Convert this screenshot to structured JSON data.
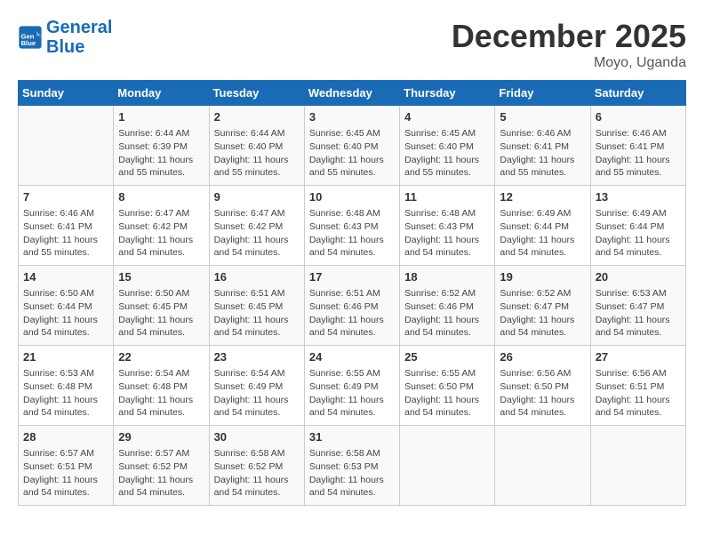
{
  "header": {
    "logo_line1": "General",
    "logo_line2": "Blue",
    "month_year": "December 2025",
    "location": "Moyo, Uganda"
  },
  "days_of_week": [
    "Sunday",
    "Monday",
    "Tuesday",
    "Wednesday",
    "Thursday",
    "Friday",
    "Saturday"
  ],
  "weeks": [
    [
      {
        "day": "",
        "sunrise": "",
        "sunset": "",
        "daylight": ""
      },
      {
        "day": "1",
        "sunrise": "Sunrise: 6:44 AM",
        "sunset": "Sunset: 6:39 PM",
        "daylight": "Daylight: 11 hours and 55 minutes."
      },
      {
        "day": "2",
        "sunrise": "Sunrise: 6:44 AM",
        "sunset": "Sunset: 6:40 PM",
        "daylight": "Daylight: 11 hours and 55 minutes."
      },
      {
        "day": "3",
        "sunrise": "Sunrise: 6:45 AM",
        "sunset": "Sunset: 6:40 PM",
        "daylight": "Daylight: 11 hours and 55 minutes."
      },
      {
        "day": "4",
        "sunrise": "Sunrise: 6:45 AM",
        "sunset": "Sunset: 6:40 PM",
        "daylight": "Daylight: 11 hours and 55 minutes."
      },
      {
        "day": "5",
        "sunrise": "Sunrise: 6:46 AM",
        "sunset": "Sunset: 6:41 PM",
        "daylight": "Daylight: 11 hours and 55 minutes."
      },
      {
        "day": "6",
        "sunrise": "Sunrise: 6:46 AM",
        "sunset": "Sunset: 6:41 PM",
        "daylight": "Daylight: 11 hours and 55 minutes."
      }
    ],
    [
      {
        "day": "7",
        "sunrise": "Sunrise: 6:46 AM",
        "sunset": "Sunset: 6:41 PM",
        "daylight": "Daylight: 11 hours and 55 minutes."
      },
      {
        "day": "8",
        "sunrise": "Sunrise: 6:47 AM",
        "sunset": "Sunset: 6:42 PM",
        "daylight": "Daylight: 11 hours and 54 minutes."
      },
      {
        "day": "9",
        "sunrise": "Sunrise: 6:47 AM",
        "sunset": "Sunset: 6:42 PM",
        "daylight": "Daylight: 11 hours and 54 minutes."
      },
      {
        "day": "10",
        "sunrise": "Sunrise: 6:48 AM",
        "sunset": "Sunset: 6:43 PM",
        "daylight": "Daylight: 11 hours and 54 minutes."
      },
      {
        "day": "11",
        "sunrise": "Sunrise: 6:48 AM",
        "sunset": "Sunset: 6:43 PM",
        "daylight": "Daylight: 11 hours and 54 minutes."
      },
      {
        "day": "12",
        "sunrise": "Sunrise: 6:49 AM",
        "sunset": "Sunset: 6:44 PM",
        "daylight": "Daylight: 11 hours and 54 minutes."
      },
      {
        "day": "13",
        "sunrise": "Sunrise: 6:49 AM",
        "sunset": "Sunset: 6:44 PM",
        "daylight": "Daylight: 11 hours and 54 minutes."
      }
    ],
    [
      {
        "day": "14",
        "sunrise": "Sunrise: 6:50 AM",
        "sunset": "Sunset: 6:44 PM",
        "daylight": "Daylight: 11 hours and 54 minutes."
      },
      {
        "day": "15",
        "sunrise": "Sunrise: 6:50 AM",
        "sunset": "Sunset: 6:45 PM",
        "daylight": "Daylight: 11 hours and 54 minutes."
      },
      {
        "day": "16",
        "sunrise": "Sunrise: 6:51 AM",
        "sunset": "Sunset: 6:45 PM",
        "daylight": "Daylight: 11 hours and 54 minutes."
      },
      {
        "day": "17",
        "sunrise": "Sunrise: 6:51 AM",
        "sunset": "Sunset: 6:46 PM",
        "daylight": "Daylight: 11 hours and 54 minutes."
      },
      {
        "day": "18",
        "sunrise": "Sunrise: 6:52 AM",
        "sunset": "Sunset: 6:46 PM",
        "daylight": "Daylight: 11 hours and 54 minutes."
      },
      {
        "day": "19",
        "sunrise": "Sunrise: 6:52 AM",
        "sunset": "Sunset: 6:47 PM",
        "daylight": "Daylight: 11 hours and 54 minutes."
      },
      {
        "day": "20",
        "sunrise": "Sunrise: 6:53 AM",
        "sunset": "Sunset: 6:47 PM",
        "daylight": "Daylight: 11 hours and 54 minutes."
      }
    ],
    [
      {
        "day": "21",
        "sunrise": "Sunrise: 6:53 AM",
        "sunset": "Sunset: 6:48 PM",
        "daylight": "Daylight: 11 hours and 54 minutes."
      },
      {
        "day": "22",
        "sunrise": "Sunrise: 6:54 AM",
        "sunset": "Sunset: 6:48 PM",
        "daylight": "Daylight: 11 hours and 54 minutes."
      },
      {
        "day": "23",
        "sunrise": "Sunrise: 6:54 AM",
        "sunset": "Sunset: 6:49 PM",
        "daylight": "Daylight: 11 hours and 54 minutes."
      },
      {
        "day": "24",
        "sunrise": "Sunrise: 6:55 AM",
        "sunset": "Sunset: 6:49 PM",
        "daylight": "Daylight: 11 hours and 54 minutes."
      },
      {
        "day": "25",
        "sunrise": "Sunrise: 6:55 AM",
        "sunset": "Sunset: 6:50 PM",
        "daylight": "Daylight: 11 hours and 54 minutes."
      },
      {
        "day": "26",
        "sunrise": "Sunrise: 6:56 AM",
        "sunset": "Sunset: 6:50 PM",
        "daylight": "Daylight: 11 hours and 54 minutes."
      },
      {
        "day": "27",
        "sunrise": "Sunrise: 6:56 AM",
        "sunset": "Sunset: 6:51 PM",
        "daylight": "Daylight: 11 hours and 54 minutes."
      }
    ],
    [
      {
        "day": "28",
        "sunrise": "Sunrise: 6:57 AM",
        "sunset": "Sunset: 6:51 PM",
        "daylight": "Daylight: 11 hours and 54 minutes."
      },
      {
        "day": "29",
        "sunrise": "Sunrise: 6:57 AM",
        "sunset": "Sunset: 6:52 PM",
        "daylight": "Daylight: 11 hours and 54 minutes."
      },
      {
        "day": "30",
        "sunrise": "Sunrise: 6:58 AM",
        "sunset": "Sunset: 6:52 PM",
        "daylight": "Daylight: 11 hours and 54 minutes."
      },
      {
        "day": "31",
        "sunrise": "Sunrise: 6:58 AM",
        "sunset": "Sunset: 6:53 PM",
        "daylight": "Daylight: 11 hours and 54 minutes."
      },
      {
        "day": "",
        "sunrise": "",
        "sunset": "",
        "daylight": ""
      },
      {
        "day": "",
        "sunrise": "",
        "sunset": "",
        "daylight": ""
      },
      {
        "day": "",
        "sunrise": "",
        "sunset": "",
        "daylight": ""
      }
    ]
  ]
}
